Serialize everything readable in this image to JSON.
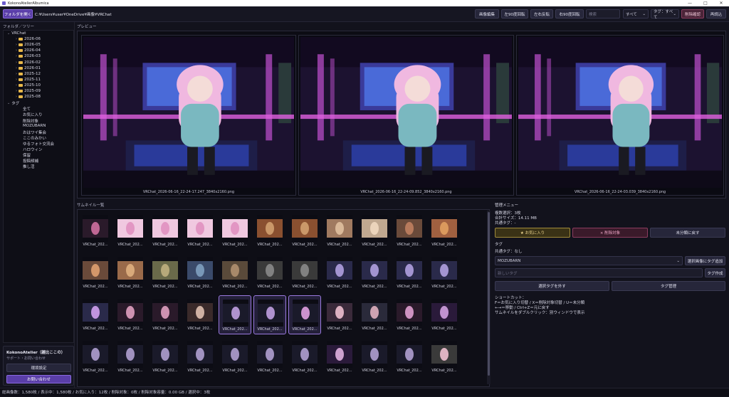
{
  "window": {
    "title": "KokonoAtelierAlbumica"
  },
  "toolbar": {
    "open_folder": "フォルダを開く",
    "path": "C:¥Users¥user¥OneDrive¥画像¥VRChat",
    "edit_image": "画像編集",
    "rotate_left": "左90度回転",
    "flip_h": "左右反転",
    "rotate_right": "右90度回転",
    "search_placeholder": "検索",
    "filter_all": "すべて",
    "tag_filter": "タグ：すべて",
    "delete_confirm": "削除確認",
    "reload": "再読込"
  },
  "sidebar": {
    "title": "フォルダ／ツリー",
    "root": "VRChat",
    "folders": [
      "2026-06",
      "2026-05",
      "2026-04",
      "2026-03",
      "2026-02",
      "2026-01",
      "2025-12",
      "2025-11",
      "2025-10",
      "2025-09",
      "2025-08"
    ],
    "tags_root": "タグ",
    "tags": [
      "全て",
      "お気に入り",
      "削除対象",
      "MOZUBARN",
      "おはワイ集会",
      "ここのみかい",
      "ゆるフォト交流会",
      "ハロウィン",
      "保留",
      "投稿候補",
      "推し活"
    ],
    "app_name": "KokonoAtelier（雑比ここの）",
    "support_text": "サポート・お問い合わせ",
    "settings_btn": "環境設定",
    "contact_btn": "お問い合わせ"
  },
  "preview": {
    "title": "プレビュー",
    "items": [
      "VRChat_2026-06-16_22-24-17.247_3840x2160.png",
      "VRChat_2026-06-16_22-24-09.852_3840x2160.png",
      "VRChat_2026-06-16_22-24-03.039_3840x2160.png"
    ]
  },
  "thumbnails": {
    "title": "サムネイル一覧",
    "label": "VRChat_202...",
    "selected": [
      26,
      27,
      28
    ]
  },
  "management": {
    "title": "管理メニュー",
    "multi_select": "複数選択：3枚",
    "total_size": "合計サイズ：14.11 MB",
    "common_tags": "共通タグ：-",
    "fav_btn": "★ お気に入り",
    "delete_target_btn": "× 削除対象",
    "unclassified_btn": "未分類に戻す",
    "tag_section": "タグ",
    "common_tags_none": "共通タグ：なし",
    "tag_select_value": "MOZUBARN",
    "add_tag_btn": "選択画像にタグ追加",
    "new_tag_placeholder": "新しいタグ",
    "create_tag_btn": "タグ作成",
    "remove_tag_btn": "選択タグを外す",
    "manage_tags_btn": "タグ管理",
    "shortcuts_title": "ショートカット：",
    "shortcut1": "F＝お気に入り切替 / X＝削除対象切替 / U＝未分類",
    "shortcut2": "←→＝移動 / Ctrl+Z＝元に戻す",
    "shortcut3": "サムネイルをダブルクリック：別ウィンドウで表示"
  },
  "status": {
    "text": "総画像数：1,580枚 / 表示中：1,580枚 / お気に入り：12枚 / 削除対象：0枚 / 削除対象容量：0.00 GB / 選択中：3枚"
  },
  "colors": {
    "accent": "#8a6ae0",
    "background": "#12121c",
    "folder": "#e8b84a"
  }
}
